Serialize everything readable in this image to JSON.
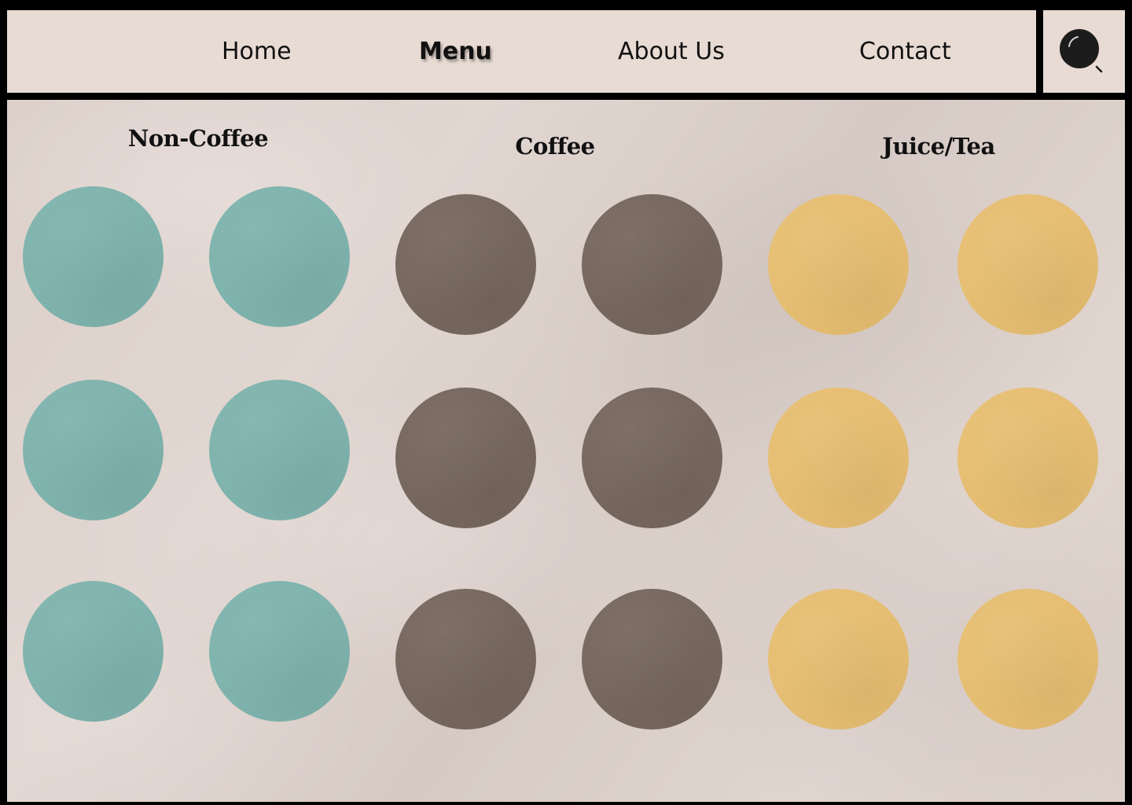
{
  "nav": {
    "home": "Home",
    "menu": "Menu",
    "about": "About Us",
    "contact": "Contact"
  },
  "search": {
    "icon": "search-icon"
  },
  "colors": {
    "nav_bg": "#e8dbd3",
    "frame": "#000000",
    "non_coffee": "#7fb3ad",
    "coffee": "#76675e",
    "juice_tea": "#e6be72"
  },
  "categories": [
    {
      "title": "Non-Coffee",
      "color": "#7fb3ad"
    },
    {
      "title": "Coffee",
      "color": "#76675e"
    },
    {
      "title": "Juice/Tea",
      "color": "#e6be72"
    }
  ]
}
